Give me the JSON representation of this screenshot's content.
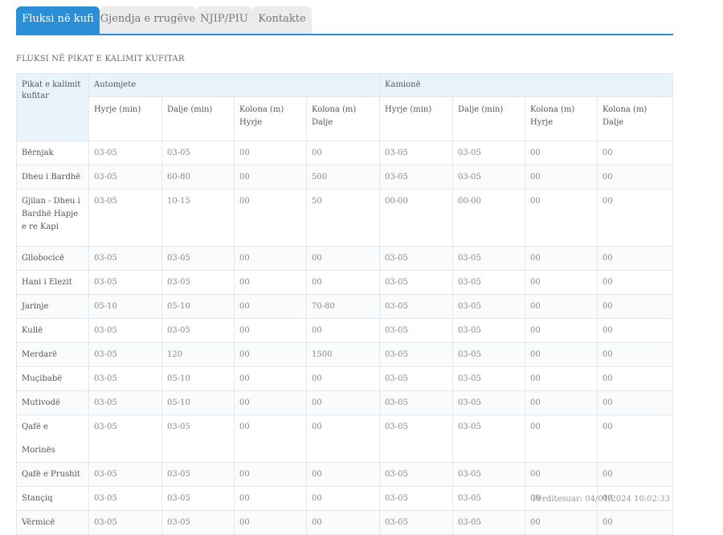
{
  "tabs": [
    {
      "label": "Fluksi në kufi",
      "active": true
    },
    {
      "label": "Gjendja e rrugëve",
      "active": false
    },
    {
      "label": "NJIP/PIU",
      "active": false
    },
    {
      "label": "Kontakte",
      "active": false
    }
  ],
  "section_title": "FLUKSI NË PIKAT E KALIMIT KUFITAR",
  "table": {
    "corner": "Pikat e kalimit kufitar",
    "groups": [
      "Automjete",
      "Kamionë"
    ],
    "subheaders": [
      "Hyrje (min)",
      "Dalje (min)",
      "Kolona (m) Hyrje",
      "Kolona (m) Dalje",
      "Hyrje (min)",
      "Dalje (min)",
      "Kolona (m) Hyrje",
      "Kolona (m) Dalje"
    ],
    "rows": [
      {
        "name": "Bërnjak",
        "cells": [
          "03-05",
          "03-05",
          "00",
          "00",
          "03-05",
          "03-05",
          "00",
          "00"
        ]
      },
      {
        "name": "Dheu i Bardhë",
        "cells": [
          "03-05",
          "60-80",
          "00",
          "500",
          "03-05",
          "03-05",
          "00",
          "00"
        ]
      },
      {
        "name": "Gjilan - Dheu i Bardhë Hapje e re Kapi",
        "cells": [
          "03-05",
          "10-15",
          "00",
          "50",
          "00-00",
          "00-00",
          "00",
          "00"
        ]
      },
      {
        "name": "Gllobocicë",
        "cells": [
          "03-05",
          "03-05",
          "00",
          "00",
          "03-05",
          "03-05",
          "00",
          "00"
        ]
      },
      {
        "name": "Hani i Elezit",
        "cells": [
          "03-05",
          "03-05",
          "00",
          "00",
          "03-05",
          "03-05",
          "00",
          "00"
        ]
      },
      {
        "name": "Jarinje",
        "cells": [
          "05-10",
          "05-10",
          "00",
          "70-80",
          "03-05",
          "03-05",
          "00",
          "00"
        ]
      },
      {
        "name": "Kullë",
        "cells": [
          "03-05",
          "03-05",
          "00",
          "00",
          "03-05",
          "03-05",
          "00",
          "00"
        ]
      },
      {
        "name": "Merdarë",
        "cells": [
          "03-05",
          "120",
          "00",
          "1500",
          "03-05",
          "03-05",
          "00",
          "00"
        ]
      },
      {
        "name": "Muçibabë",
        "cells": [
          "03-05",
          "05-10",
          "00",
          "00",
          "03-05",
          "03-05",
          "00",
          "00"
        ]
      },
      {
        "name": "Mutivodë",
        "cells": [
          "03-05",
          "05-10",
          "00",
          "00",
          "03-05",
          "03-05",
          "00",
          "00"
        ]
      },
      {
        "name": "Qafë e Morinës",
        "cells": [
          "03-05",
          "03-05",
          "00",
          "00",
          "03-05",
          "03-05",
          "00",
          "00"
        ]
      },
      {
        "name": "Qafë e Prushit",
        "cells": [
          "03-05",
          "03-05",
          "00",
          "00",
          "03-05",
          "03-05",
          "00",
          "00"
        ]
      },
      {
        "name": "Stançiq",
        "cells": [
          "03-05",
          "03-05",
          "00",
          "00",
          "03-05",
          "03-05",
          "00",
          "00"
        ]
      },
      {
        "name": "Vërmicë",
        "cells": [
          "03-05",
          "03-05",
          "00",
          "00",
          "03-05",
          "03-05",
          "00",
          "00"
        ]
      }
    ]
  },
  "updated": "Përditesuar: 04/01/2024 10:02:33",
  "colors": {
    "accent": "#2a8fd6",
    "header_bg": "#e8f3fb"
  }
}
